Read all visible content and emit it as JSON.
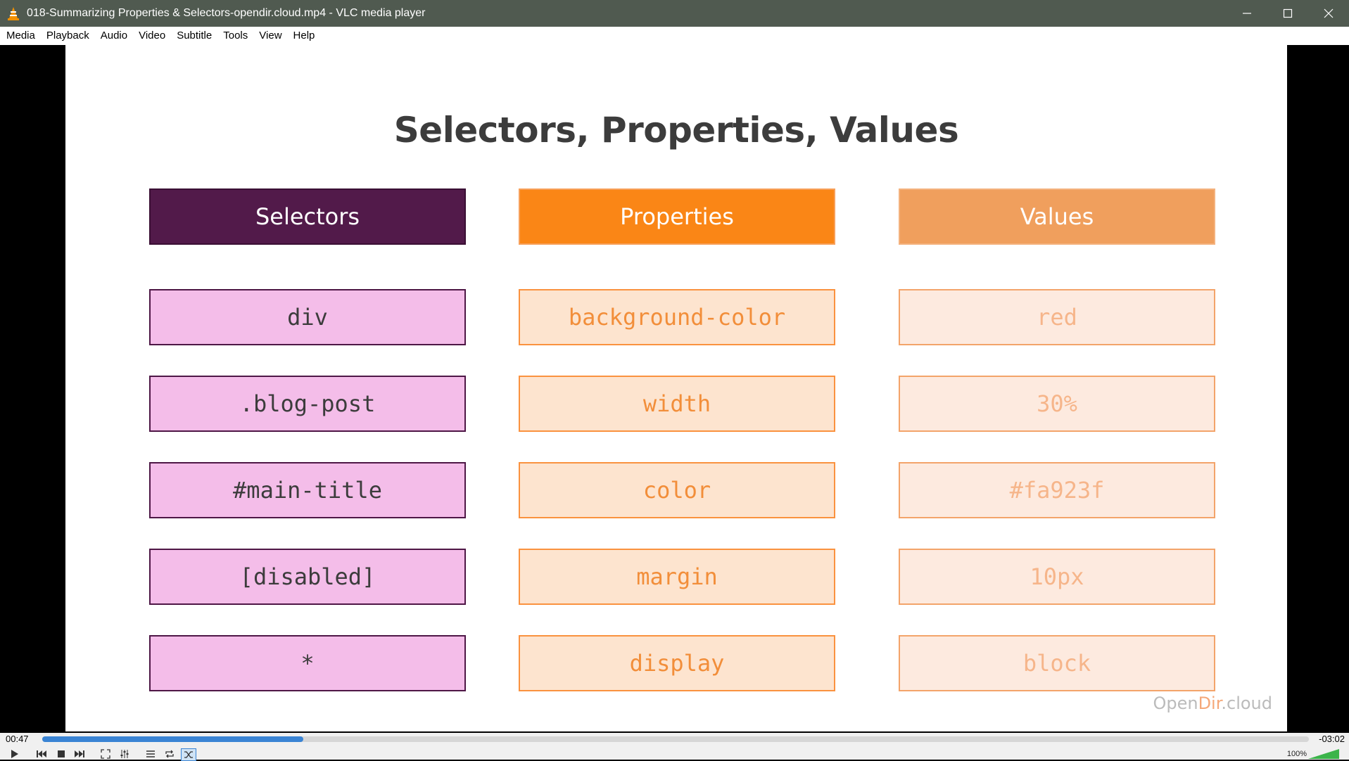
{
  "window": {
    "title": "018-Summarizing Properties & Selectors-opendir.cloud.mp4 - VLC media player",
    "icon": "vlc-cone-icon",
    "controls": [
      "minimize-icon",
      "maximize-icon",
      "close-icon"
    ]
  },
  "menu": {
    "items": [
      {
        "label": "Media"
      },
      {
        "label": "Playback"
      },
      {
        "label": "Audio"
      },
      {
        "label": "Video"
      },
      {
        "label": "Subtitle"
      },
      {
        "label": "Tools"
      },
      {
        "label": "View"
      },
      {
        "label": "Help"
      }
    ]
  },
  "slide": {
    "title": "Selectors, Properties, Values",
    "headers": {
      "selectors": "Selectors",
      "properties": "Properties",
      "values": "Values"
    },
    "selectors": [
      "div",
      ".blog-post",
      "#main-title",
      "[disabled]",
      "*"
    ],
    "properties": [
      "background-color",
      "width",
      "color",
      "margin",
      "display"
    ],
    "values": [
      "red",
      "30%",
      "#fa923f",
      "10px",
      "block"
    ],
    "watermark": {
      "part1": "Open",
      "part2": "Dir",
      "part3": ".cloud"
    },
    "colors": {
      "selectors_header": "#521a4a",
      "properties_header": "#fa8616",
      "values_header": "#f09f5d"
    }
  },
  "player": {
    "time_elapsed": "00:47",
    "time_remaining": "-03:02",
    "progress_fraction": 0.206,
    "volume": "100%",
    "buttons": [
      "play-icon",
      "previous-icon",
      "stop-icon",
      "next-icon",
      "fullscreen-icon",
      "extended-settings-icon",
      "playlist-icon",
      "loop-icon",
      "shuffle-icon"
    ]
  }
}
